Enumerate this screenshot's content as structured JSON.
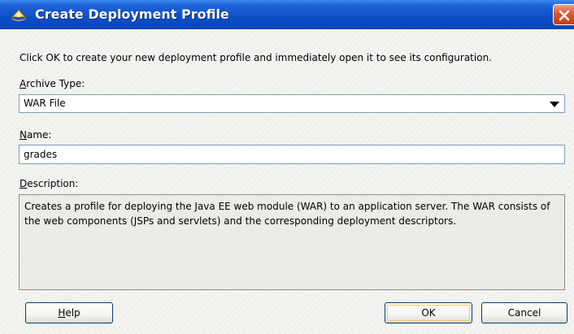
{
  "window": {
    "title": "Create Deployment Profile",
    "close_icon": "close-icon",
    "app_icon": "deployment-icon"
  },
  "intro": "Click OK to create your new deployment profile and immediately open it to see its configuration.",
  "archive_type": {
    "label_mnemonic": "A",
    "label_rest": "rchive Type:",
    "selected": "WAR File"
  },
  "name": {
    "label_mnemonic": "N",
    "label_rest": "ame:",
    "value": "grades"
  },
  "description": {
    "label_mnemonic": "D",
    "label_rest": "escription:",
    "text": "Creates a profile for deploying the Java EE web module (WAR) to an application server. The WAR consists of the web components (JSPs and servlets) and the corresponding deployment descriptors."
  },
  "buttons": {
    "help_mnemonic": "H",
    "help_rest": "elp",
    "ok": "OK",
    "cancel": "Cancel"
  },
  "colors": {
    "titlebar": "#0d4fc6",
    "close": "#d8582c",
    "dialog_bg": "#f0f0ec",
    "field_border": "#7f9db9"
  }
}
